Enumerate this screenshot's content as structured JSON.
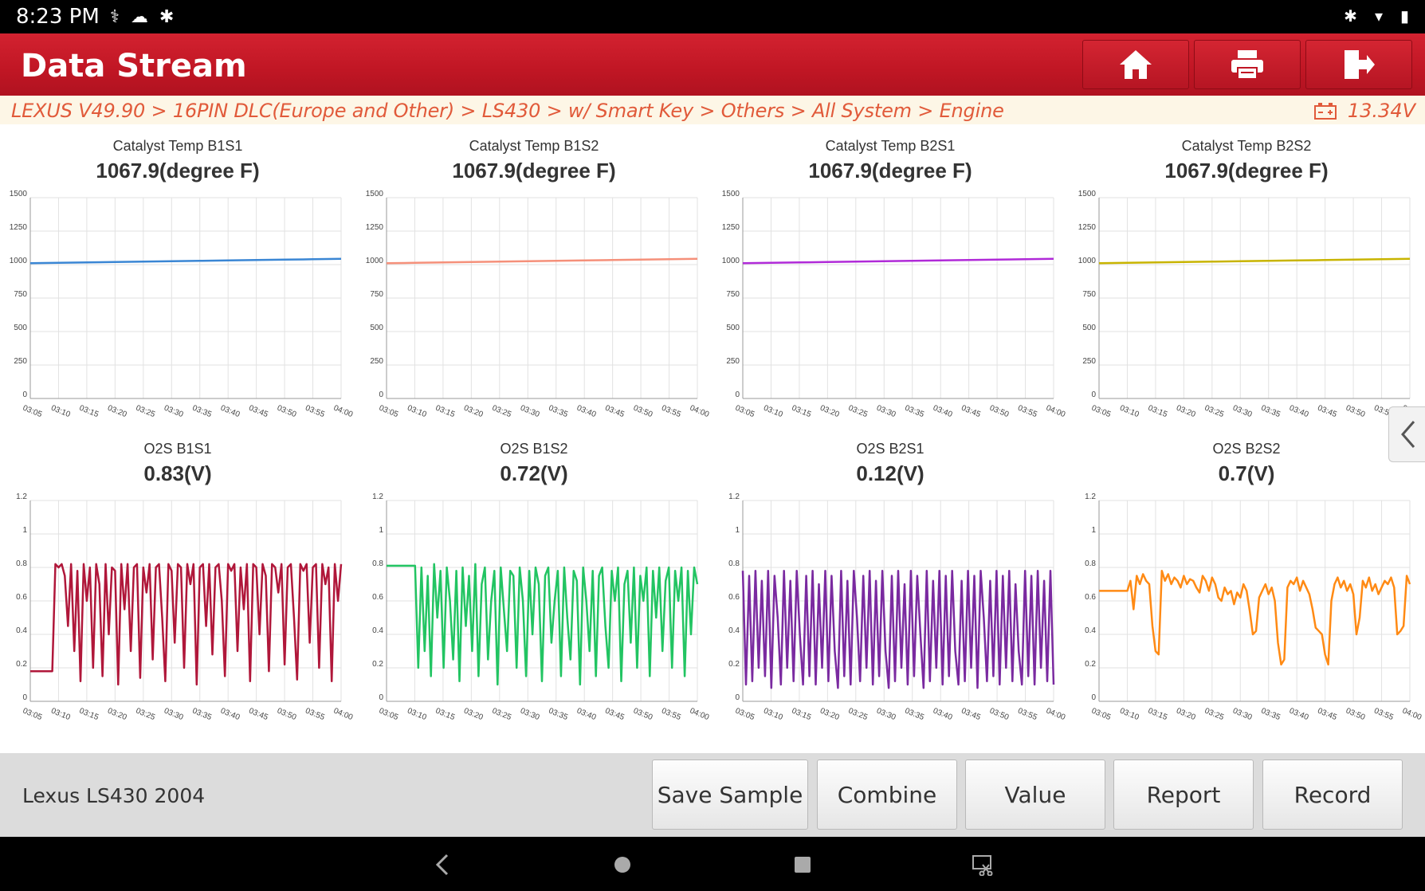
{
  "status_bar": {
    "time": "8:23 PM",
    "left_icons": [
      "stethoscope-icon",
      "cloud-icon",
      "bluetooth-circle-icon"
    ],
    "right_icons": [
      "bluetooth-icon",
      "wifi-icon",
      "battery-icon"
    ]
  },
  "header": {
    "title": "Data Stream",
    "buttons": [
      "home-icon",
      "printer-icon",
      "exit-icon"
    ]
  },
  "breadcrumb": {
    "path": "LEXUS V49.90 > 16PIN DLC(Europe and Other) > LS430 > w/ Smart Key > Others > All System > Engine",
    "voltage": "13.34V"
  },
  "x_tick_labels": [
    "03:05",
    "03:10",
    "03:15",
    "03:20",
    "03:25",
    "03:30",
    "03:35",
    "03:40",
    "03:45",
    "03:50",
    "03:55",
    "04:00"
  ],
  "chart_data": [
    {
      "type": "line",
      "title": "Catalyst Temp B1S1",
      "value_label": "1067.9(degree F)",
      "color": "#3a86d4",
      "ylim": [
        0,
        1500
      ],
      "yticks": [
        0,
        250,
        500,
        750,
        1000,
        1250,
        1500
      ],
      "x": [
        "03:05",
        "04:00"
      ],
      "series": [
        {
          "values": [
            1010,
            1013,
            1016,
            1019,
            1022,
            1025,
            1028,
            1031,
            1034,
            1037,
            1040,
            1043
          ]
        }
      ]
    },
    {
      "type": "line",
      "title": "Catalyst Temp B1S2",
      "value_label": "1067.9(degree F)",
      "color": "#f5907a",
      "ylim": [
        0,
        1500
      ],
      "yticks": [
        0,
        250,
        500,
        750,
        1000,
        1250,
        1500
      ],
      "x": [
        "03:05",
        "04:00"
      ],
      "series": [
        {
          "values": [
            1010,
            1013,
            1016,
            1019,
            1022,
            1025,
            1028,
            1031,
            1034,
            1037,
            1040,
            1043
          ]
        }
      ]
    },
    {
      "type": "line",
      "title": "Catalyst Temp B2S1",
      "value_label": "1067.9(degree F)",
      "color": "#b02ad8",
      "ylim": [
        0,
        1500
      ],
      "yticks": [
        0,
        250,
        500,
        750,
        1000,
        1250,
        1500
      ],
      "x": [
        "03:05",
        "04:00"
      ],
      "series": [
        {
          "values": [
            1010,
            1013,
            1016,
            1019,
            1022,
            1025,
            1028,
            1031,
            1034,
            1037,
            1040,
            1043
          ]
        }
      ]
    },
    {
      "type": "line",
      "title": "Catalyst Temp B2S2",
      "value_label": "1067.9(degree F)",
      "color": "#c8b400",
      "ylim": [
        0,
        1500
      ],
      "yticks": [
        0,
        250,
        500,
        750,
        1000,
        1250,
        1500
      ],
      "x": [
        "03:05",
        "04:00"
      ],
      "series": [
        {
          "values": [
            1010,
            1013,
            1016,
            1019,
            1022,
            1025,
            1028,
            1031,
            1034,
            1037,
            1040,
            1043
          ]
        }
      ]
    },
    {
      "type": "line",
      "title": "O2S B1S1",
      "value_label": "0.83(V)",
      "color": "#b0173a",
      "ylim": [
        0,
        1.2
      ],
      "yticks": [
        0,
        0.2,
        0.4,
        0.6,
        0.8,
        1,
        1.2
      ],
      "x": [
        "03:05",
        "04:00"
      ],
      "series": [
        {
          "values": [
            0.18,
            0.18,
            0.18,
            0.18,
            0.18,
            0.18,
            0.18,
            0.18,
            0.82,
            0.8,
            0.82,
            0.75,
            0.45,
            0.82,
            0.3,
            0.78,
            0.12,
            0.82,
            0.6,
            0.8,
            0.2,
            0.82,
            0.7,
            0.15,
            0.82,
            0.4,
            0.8,
            0.78,
            0.1,
            0.82,
            0.55,
            0.82,
            0.3,
            0.8,
            0.82,
            0.14,
            0.8,
            0.65,
            0.82,
            0.25,
            0.8,
            0.82,
            0.5,
            0.12,
            0.82,
            0.78,
            0.35,
            0.82,
            0.8,
            0.2,
            0.82,
            0.7,
            0.82,
            0.1,
            0.8,
            0.82,
            0.45,
            0.82,
            0.28,
            0.8,
            0.82,
            0.6,
            0.15,
            0.82,
            0.78,
            0.82,
            0.3,
            0.8,
            0.55,
            0.82,
            0.12,
            0.82,
            0.8,
            0.4,
            0.82,
            0.75,
            0.18,
            0.82,
            0.8,
            0.65,
            0.82,
            0.22,
            0.8,
            0.82,
            0.5,
            0.13,
            0.82,
            0.78,
            0.82,
            0.35,
            0.8,
            0.82,
            0.2,
            0.82,
            0.7,
            0.8,
            0.12,
            0.82,
            0.6,
            0.82
          ]
        }
      ]
    },
    {
      "type": "line",
      "title": "O2S B1S2",
      "value_label": "0.72(V)",
      "color": "#22c462",
      "ylim": [
        0,
        1.2
      ],
      "yticks": [
        0,
        0.2,
        0.4,
        0.6,
        0.8,
        1,
        1.2
      ],
      "x": [
        "03:05",
        "04:00"
      ],
      "series": [
        {
          "values": [
            0.81,
            0.81,
            0.81,
            0.81,
            0.81,
            0.81,
            0.81,
            0.81,
            0.81,
            0.81,
            0.2,
            0.8,
            0.3,
            0.75,
            0.15,
            0.82,
            0.5,
            0.78,
            0.2,
            0.8,
            0.6,
            0.25,
            0.78,
            0.12,
            0.8,
            0.45,
            0.75,
            0.3,
            0.82,
            0.15,
            0.7,
            0.8,
            0.25,
            0.6,
            0.78,
            0.1,
            0.8,
            0.55,
            0.3,
            0.78,
            0.75,
            0.2,
            0.8,
            0.6,
            0.15,
            0.78,
            0.4,
            0.8,
            0.7,
            0.12,
            0.75,
            0.8,
            0.35,
            0.6,
            0.78,
            0.15,
            0.8,
            0.5,
            0.25,
            0.78,
            0.72,
            0.1,
            0.8,
            0.6,
            0.3,
            0.78,
            0.15,
            0.75,
            0.8,
            0.45,
            0.2,
            0.78,
            0.6,
            0.8,
            0.12,
            0.7,
            0.78,
            0.35,
            0.8,
            0.2,
            0.75,
            0.6,
            0.8,
            0.15,
            0.78,
            0.5,
            0.8,
            0.3,
            0.72,
            0.8,
            0.2,
            0.78,
            0.6,
            0.8,
            0.15,
            0.78,
            0.4,
            0.8,
            0.7
          ]
        }
      ]
    },
    {
      "type": "line",
      "title": "O2S B2S1",
      "value_label": "0.12(V)",
      "color": "#7a2aa0",
      "ylim": [
        0,
        1.2
      ],
      "yticks": [
        0,
        0.2,
        0.4,
        0.6,
        0.8,
        1,
        1.2
      ],
      "x": [
        "03:05",
        "04:00"
      ],
      "series": [
        {
          "values": [
            0.78,
            0.1,
            0.75,
            0.12,
            0.78,
            0.2,
            0.72,
            0.15,
            0.78,
            0.08,
            0.75,
            0.5,
            0.1,
            0.78,
            0.2,
            0.72,
            0.12,
            0.78,
            0.4,
            0.1,
            0.75,
            0.15,
            0.78,
            0.1,
            0.7,
            0.2,
            0.78,
            0.12,
            0.75,
            0.3,
            0.08,
            0.78,
            0.15,
            0.72,
            0.1,
            0.78,
            0.5,
            0.12,
            0.75,
            0.2,
            0.78,
            0.1,
            0.72,
            0.15,
            0.78,
            0.3,
            0.08,
            0.75,
            0.12,
            0.78,
            0.2,
            0.7,
            0.1,
            0.78,
            0.15,
            0.75,
            0.4,
            0.08,
            0.78,
            0.12,
            0.72,
            0.2,
            0.78,
            0.1,
            0.75,
            0.15,
            0.78,
            0.3,
            0.1,
            0.72,
            0.12,
            0.78,
            0.2,
            0.75,
            0.08,
            0.78,
            0.5,
            0.12,
            0.72,
            0.15,
            0.78,
            0.1,
            0.75,
            0.2,
            0.78,
            0.12,
            0.7,
            0.3,
            0.1,
            0.78,
            0.15,
            0.75,
            0.1,
            0.78,
            0.2,
            0.72,
            0.12,
            0.78,
            0.1
          ]
        }
      ]
    },
    {
      "type": "line",
      "title": "O2S B2S2",
      "value_label": "0.7(V)",
      "color": "#ff8a14",
      "ylim": [
        0,
        1.2
      ],
      "yticks": [
        0,
        0.2,
        0.4,
        0.6,
        0.8,
        1,
        1.2
      ],
      "x": [
        "03:05",
        "04:00"
      ],
      "series": [
        {
          "values": [
            0.66,
            0.66,
            0.66,
            0.66,
            0.66,
            0.66,
            0.66,
            0.66,
            0.66,
            0.66,
            0.72,
            0.55,
            0.75,
            0.7,
            0.76,
            0.72,
            0.7,
            0.45,
            0.3,
            0.28,
            0.78,
            0.72,
            0.76,
            0.7,
            0.74,
            0.72,
            0.68,
            0.75,
            0.7,
            0.73,
            0.72,
            0.68,
            0.65,
            0.75,
            0.72,
            0.66,
            0.74,
            0.7,
            0.62,
            0.6,
            0.68,
            0.64,
            0.66,
            0.58,
            0.65,
            0.62,
            0.7,
            0.66,
            0.54,
            0.4,
            0.42,
            0.62,
            0.66,
            0.7,
            0.64,
            0.68,
            0.6,
            0.35,
            0.22,
            0.25,
            0.68,
            0.72,
            0.7,
            0.74,
            0.66,
            0.72,
            0.68,
            0.64,
            0.55,
            0.44,
            0.42,
            0.4,
            0.28,
            0.22,
            0.6,
            0.7,
            0.74,
            0.68,
            0.72,
            0.66,
            0.7,
            0.64,
            0.4,
            0.5,
            0.72,
            0.68,
            0.74,
            0.66,
            0.7,
            0.64,
            0.68,
            0.72,
            0.7,
            0.74,
            0.68,
            0.4,
            0.42,
            0.45,
            0.75,
            0.7
          ]
        }
      ]
    }
  ],
  "footer": {
    "vehicle": "Lexus LS430 2004",
    "buttons": [
      "Save Sample",
      "Combine",
      "Value",
      "Report",
      "Record"
    ]
  },
  "nav_bar": [
    "back-icon",
    "home-circle-icon",
    "recents-square-icon",
    "screenshot-icon"
  ]
}
